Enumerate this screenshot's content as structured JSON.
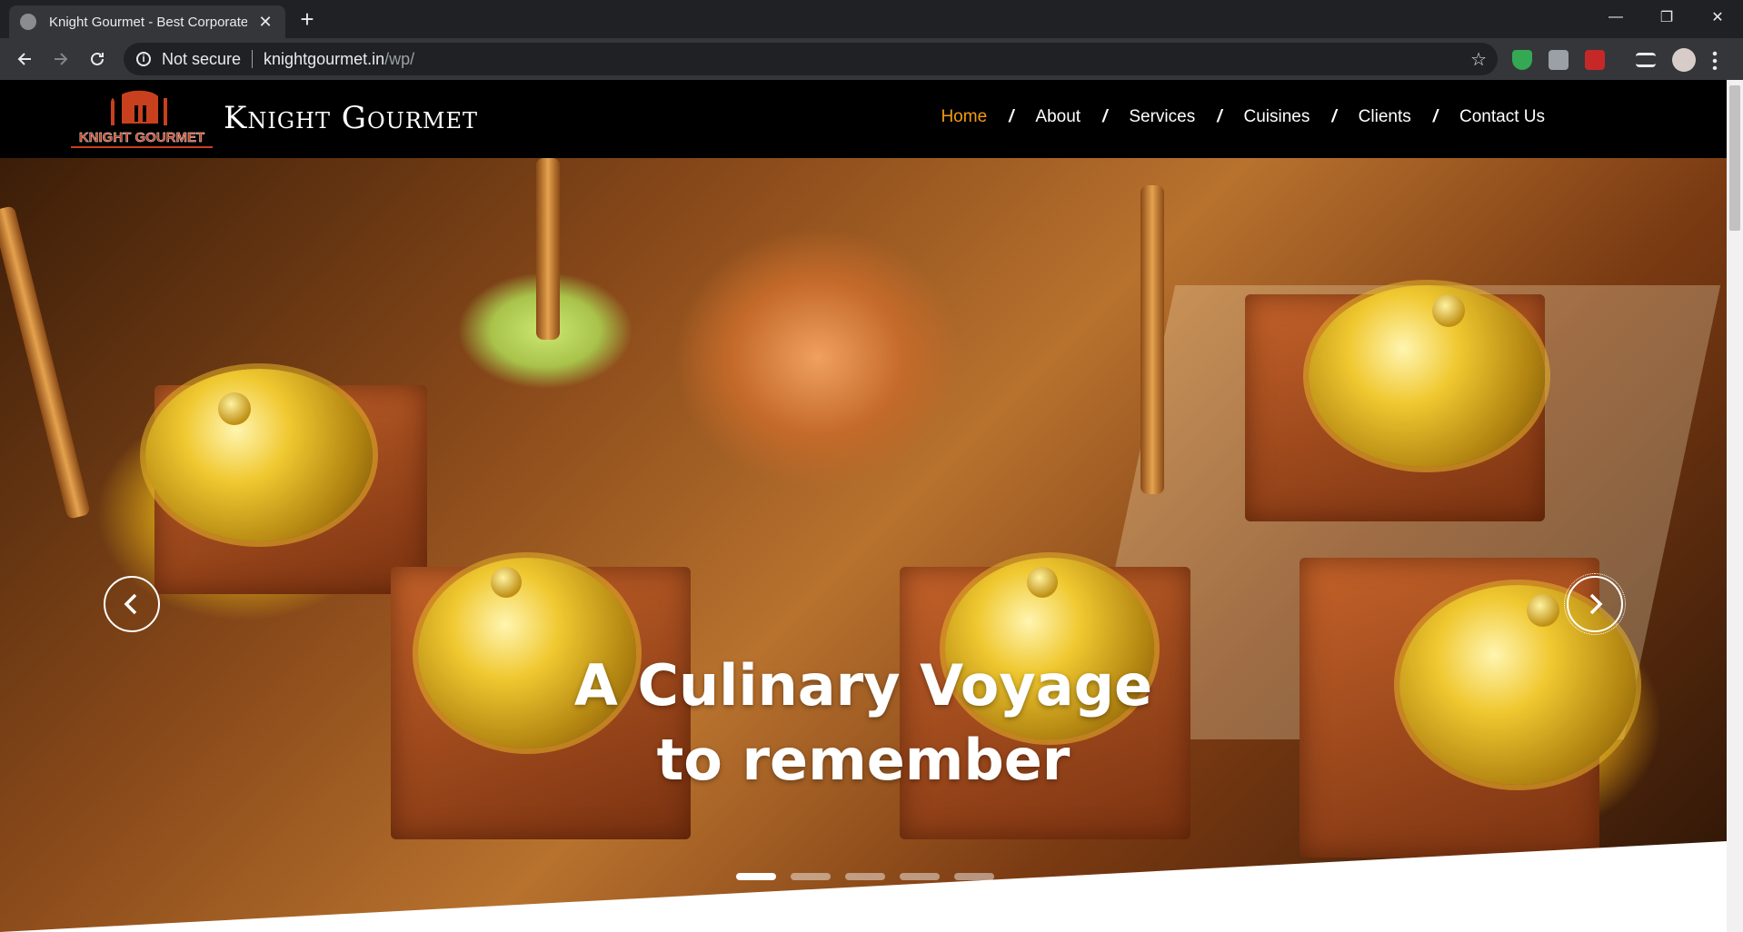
{
  "browser": {
    "tab_title": "Knight Gourmet - Best Corporate",
    "new_tab_label": "+",
    "tab_close_label": "✕",
    "security_label": "Not secure",
    "url_host": "knightgourmet.in",
    "url_path": "/wp/",
    "minimize_label": "—",
    "maximize_label": "❐",
    "close_label": "✕"
  },
  "site": {
    "brand": "Knight Gourmet",
    "logo_text": "KNIGHT GOURMET",
    "nav": [
      {
        "label": "Home",
        "active": true
      },
      {
        "label": "About",
        "active": false
      },
      {
        "label": "Services",
        "active": false
      },
      {
        "label": "Cuisines",
        "active": false
      },
      {
        "label": "Clients",
        "active": false
      },
      {
        "label": "Contact Us",
        "active": false
      }
    ],
    "nav_separator": "/",
    "accent_color": "#f39c12"
  },
  "hero": {
    "caption_line1": "A Culinary Voyage",
    "caption_line2": "to remember",
    "slide_count": 5,
    "active_slide": 1
  },
  "icons": {
    "prev": "chevron-left-icon",
    "next": "chevron-right-icon"
  }
}
